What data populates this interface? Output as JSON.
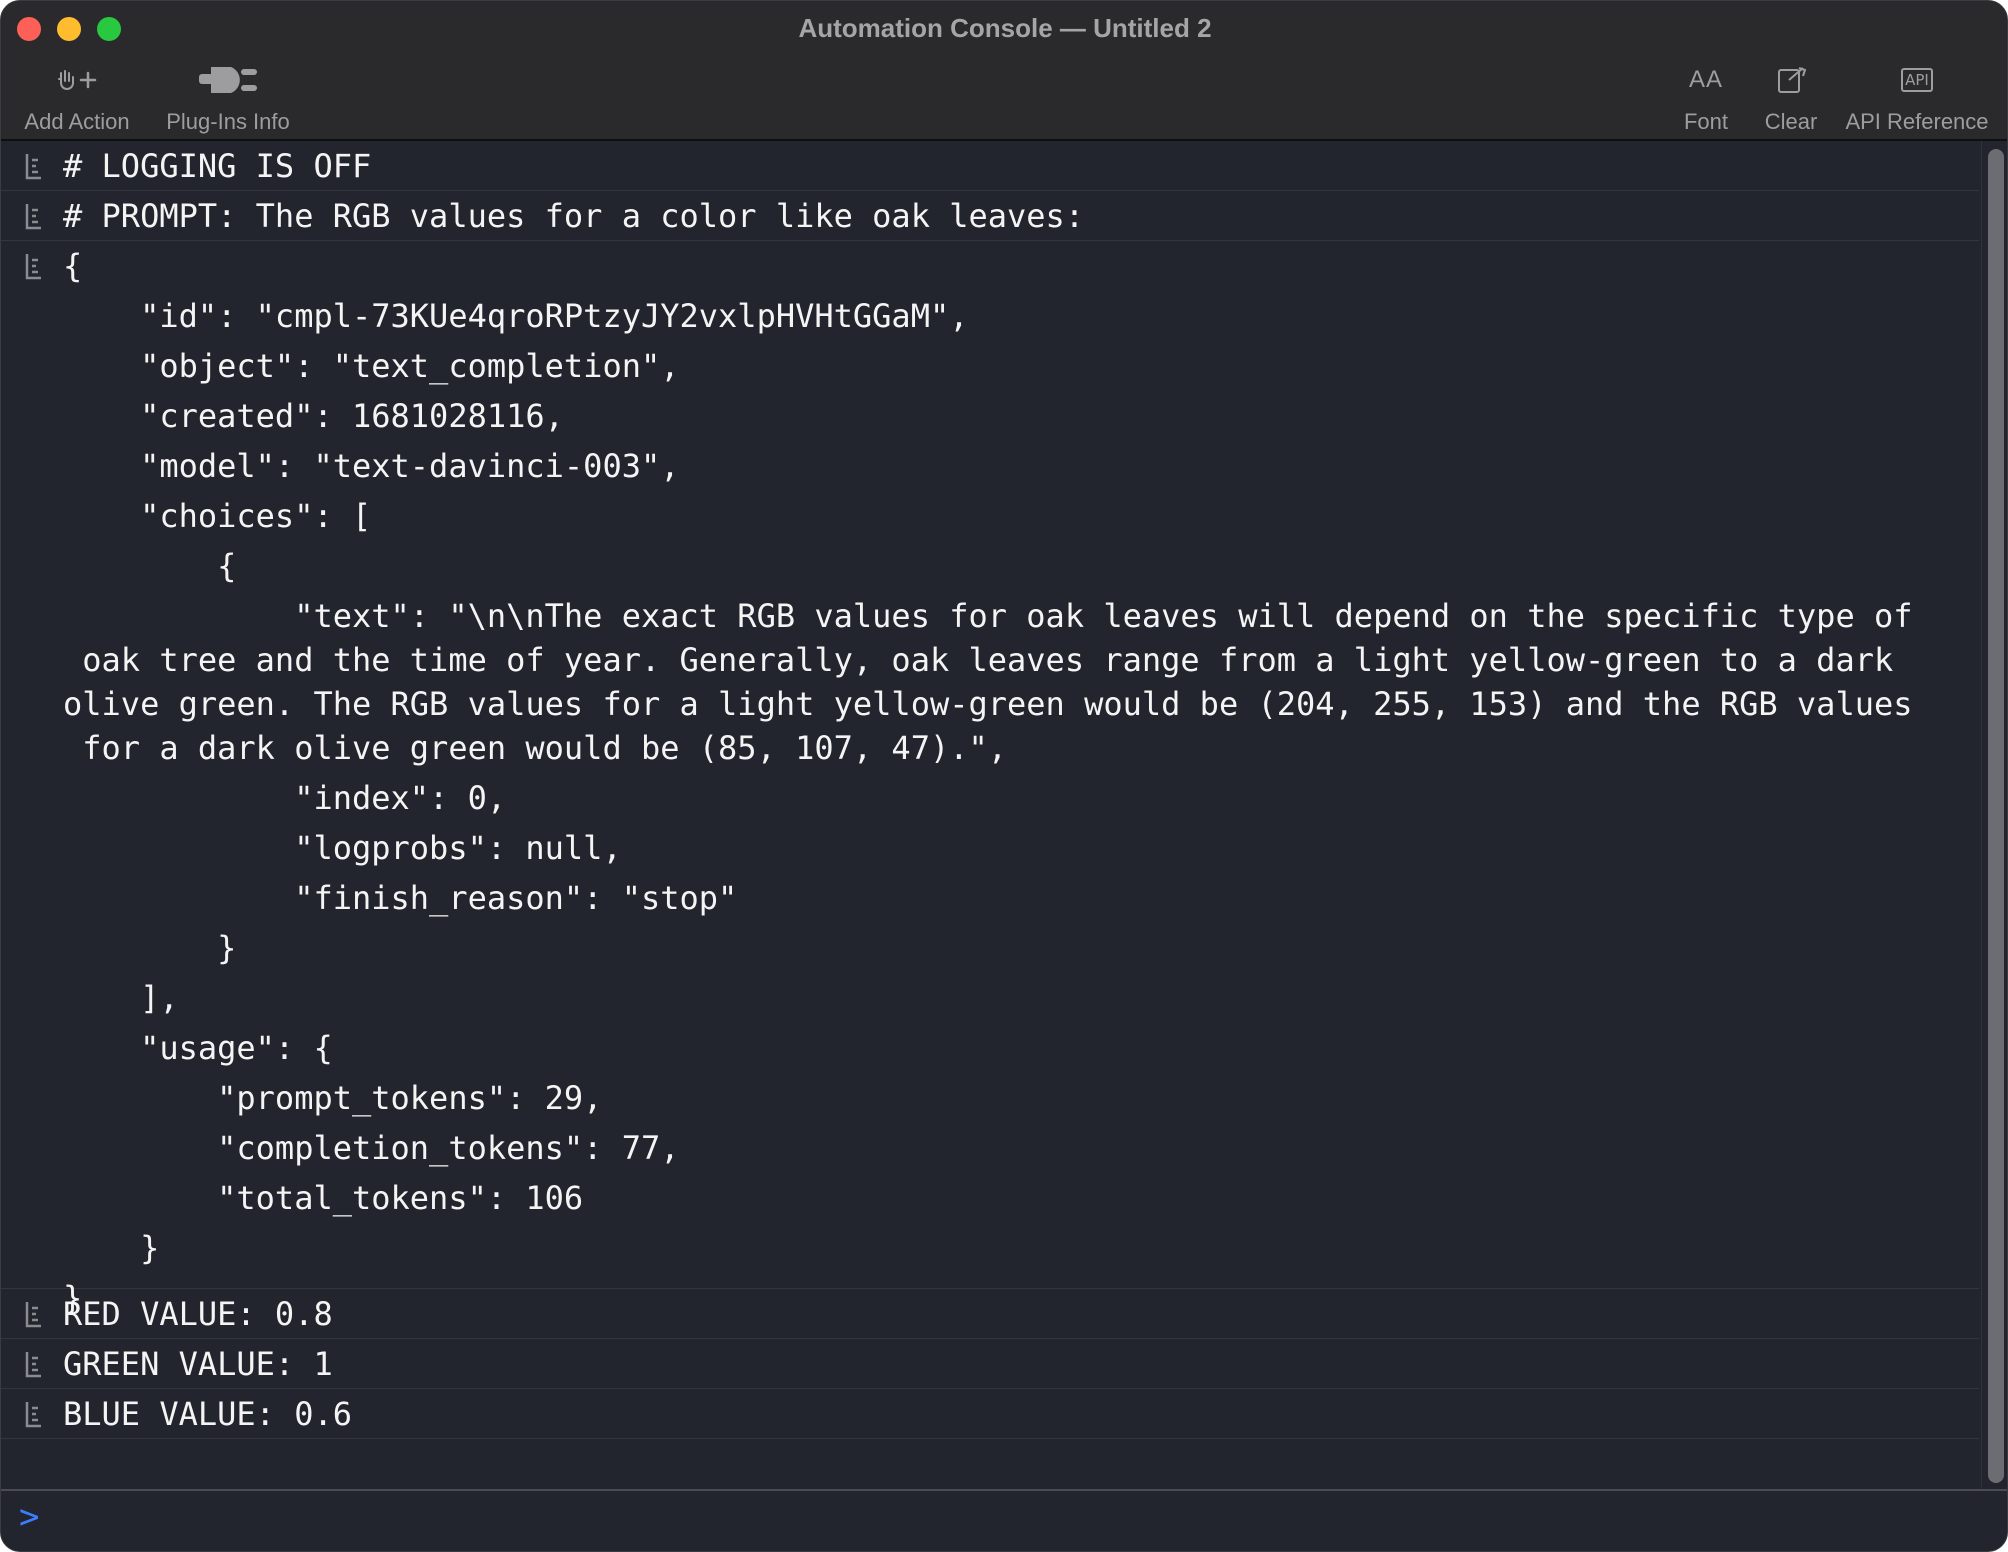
{
  "window": {
    "title": "Automation Console — Untitled 2"
  },
  "toolbar": {
    "add_action": "Add Action",
    "plugins_info": "Plug-Ins Info",
    "font": "Font",
    "font_icon_text": "AA",
    "clear": "Clear",
    "api_reference": "API Reference",
    "api_icon_text": "API"
  },
  "icons": {
    "add_action": "hand-plus-icon",
    "plugins_info": "plug-icon",
    "font": "font-size-icon",
    "clear": "clear-icon",
    "api_reference": "api-icon",
    "log_entry": "log-entry-icon"
  },
  "console": {
    "entries": [
      {
        "lines": [
          "# LOGGING IS OFF"
        ]
      },
      {
        "lines": [
          "# PROMPT: The RGB values for a color like oak leaves:"
        ]
      },
      {
        "lines": [
          "{",
          "    \"id\": \"cmpl-73KUe4qroRPtzyJY2vxlpHVHtGGaM\",",
          "    \"object\": \"text_completion\",",
          "    \"created\": 1681028116,",
          "    \"model\": \"text-davinci-003\",",
          "    \"choices\": [",
          "        {",
          "            \"text\": \"\\n\\nThe exact RGB values for oak leaves will depend on the specific type of",
          " oak tree and the time of year. Generally, oak leaves range from a light yellow-green to a dark",
          "olive green. The RGB values for a light yellow-green would be (204, 255, 153) and the RGB values",
          " for a dark olive green would be (85, 107, 47).\",",
          "            \"index\": 0,",
          "            \"logprobs\": null,",
          "            \"finish_reason\": \"stop\"",
          "        }",
          "    ],",
          "    \"usage\": {",
          "        \"prompt_tokens\": 29,",
          "        \"completion_tokens\": 77,",
          "        \"total_tokens\": 106",
          "    }",
          "}"
        ]
      },
      {
        "lines": [
          "RED VALUE: 0.8"
        ]
      },
      {
        "lines": [
          "GREEN VALUE: 1"
        ]
      },
      {
        "lines": [
          "BLUE VALUE: 0.6"
        ]
      }
    ]
  },
  "input": {
    "prompt_symbol": ">",
    "value": ""
  },
  "colors": {
    "background": "#22252d",
    "titlebar": "#2a2a2c",
    "text": "#f4f4f4",
    "caret": "#3d7dff"
  }
}
